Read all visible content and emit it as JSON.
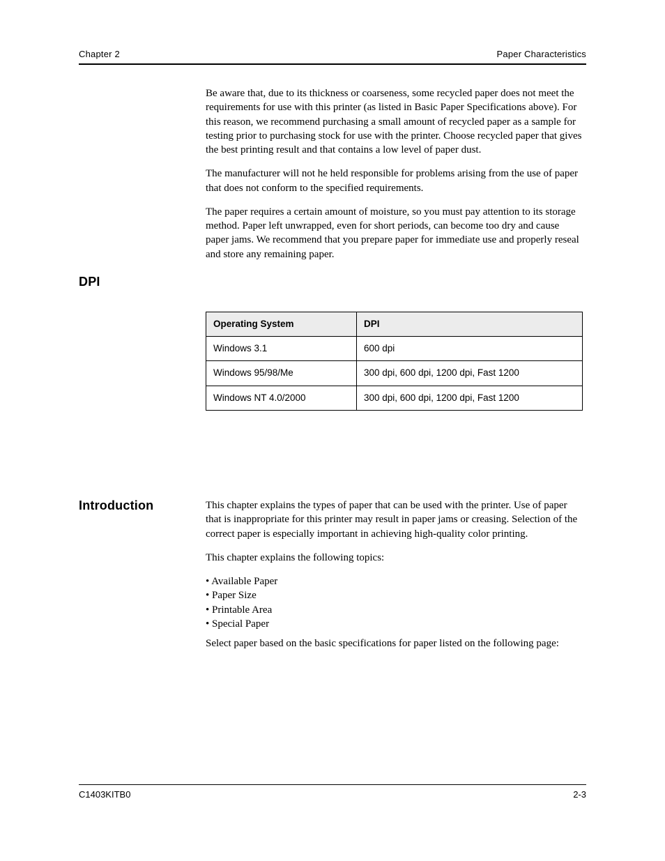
{
  "header": {
    "left": "Chapter 2",
    "right": "Paper Characteristics"
  },
  "body": {
    "p1": "Be aware that, due to its thickness or coarseness, some recycled paper does not meet the requirements for use with this printer (as listed in Basic Paper Specifications above). For this reason, we recommend purchasing a small amount of recycled paper as a sample for testing prior to purchasing stock for use with the printer. Choose recycled paper that gives the best printing result and that contains a low level of paper dust.",
    "p2": "The manufacturer will not he held responsible for problems arising from the use of paper that does not conform to the specified requirements.",
    "p3": "The paper requires a certain amount of moisture, so you must pay attention to its storage method. Paper left unwrapped, even for short periods, can become too dry and cause paper jams. We recommend that you prepare paper for immediate use and properly reseal and store any remaining paper."
  },
  "heading_dpi": "DPI",
  "heading_intro": "Introduction",
  "table": {
    "headers": [
      "Operating System",
      "DPI"
    ],
    "rows": [
      [
        "Windows 3.1",
        "600 dpi"
      ],
      [
        "Windows 95/98/Me",
        "300 dpi, 600 dpi, 1200 dpi, Fast 1200"
      ],
      [
        "Windows NT 4.0/2000",
        "300 dpi, 600 dpi, 1200 dpi, Fast 1200"
      ]
    ]
  },
  "intro": {
    "p1": "This chapter explains the types of paper that can be used with the printer. Use of paper that is inappropriate for this printer may result in paper jams or creasing. Selection of the correct paper is especially important in achieving high-quality color printing.",
    "p2": "This chapter explains the following topics:",
    "bullets": [
      "Available Paper",
      "Paper Size",
      "Printable Area",
      "Special Paper"
    ],
    "p3": "Select paper based on the basic specifications for paper listed on the following page:"
  },
  "footer": {
    "left": "C1403KITB0",
    "right": "2-3"
  }
}
